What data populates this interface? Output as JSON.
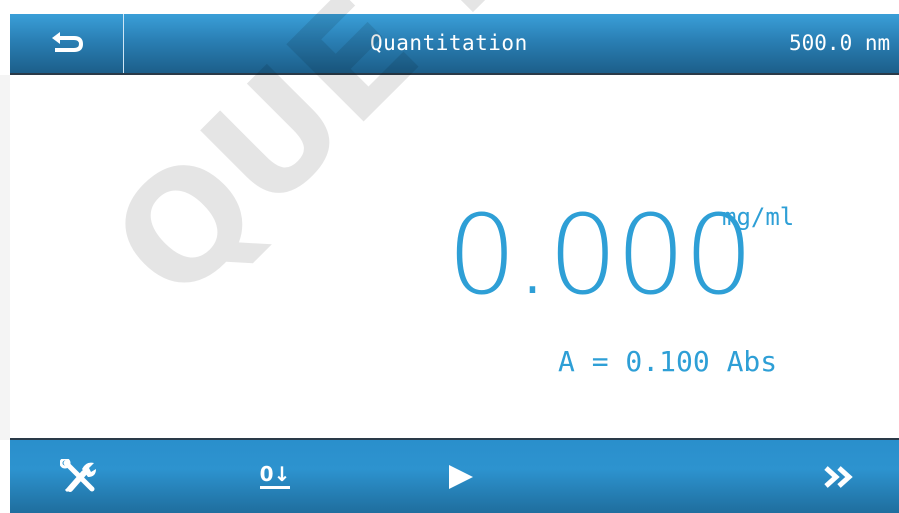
{
  "header": {
    "back_icon": "back-arrow-icon",
    "title": "Quantitation",
    "wavelength": "500.0 nm"
  },
  "reading": {
    "value": "0.000",
    "unit": "mg/ml",
    "absorbance": "A = 0.100 Abs"
  },
  "toolbar": {
    "settings_icon": "tools-icon",
    "zero_label": "0",
    "zero_icon": "zero-down-arrow-icon",
    "run_icon": "play-icon",
    "next_icon": "double-chevron-right-icon"
  },
  "watermark": "QUE DUTSCHER",
  "colors": {
    "accent": "#2e9fd6",
    "bar": "#2a7fb4",
    "background": "#ffffff"
  }
}
